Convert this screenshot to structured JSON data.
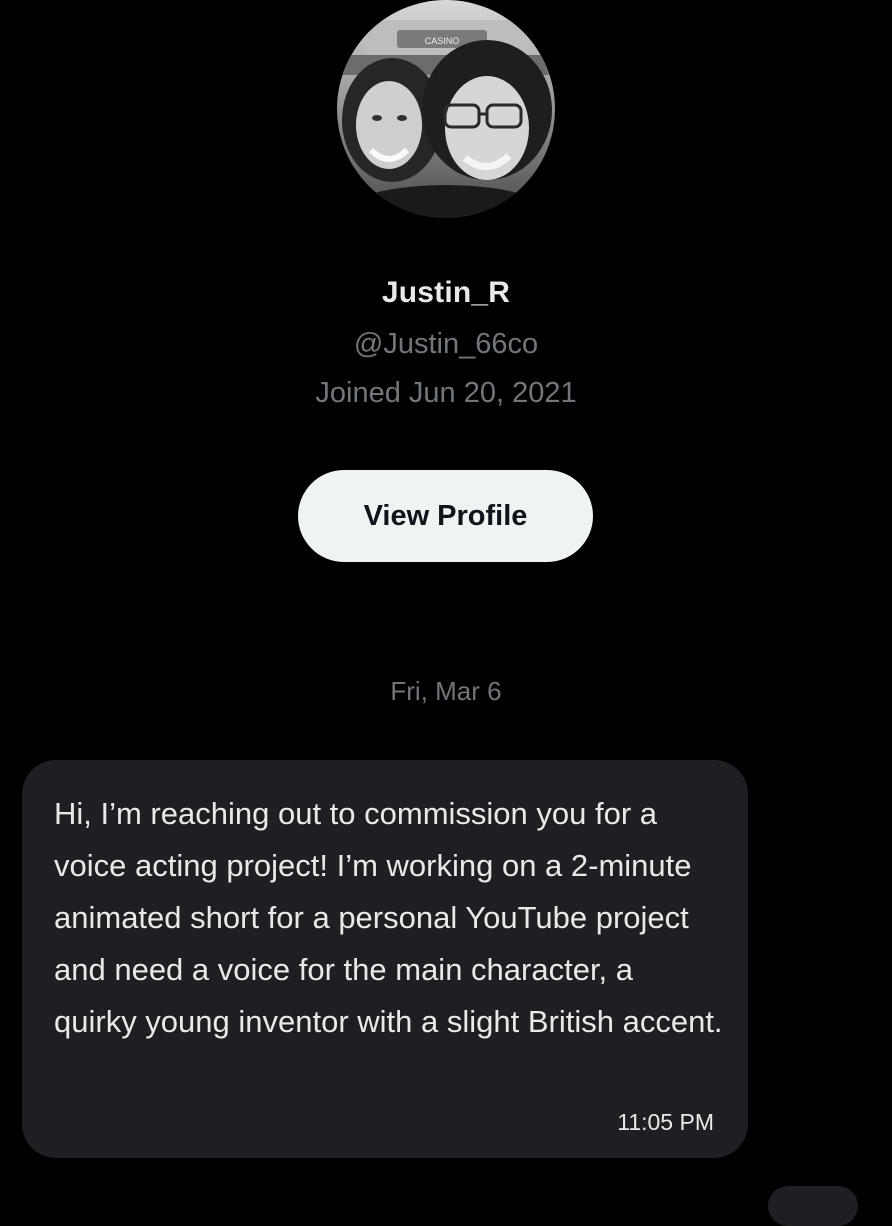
{
  "profile": {
    "display_name": "Justin_R",
    "handle": "@Justin_66co",
    "joined": "Joined Jun 20, 2021",
    "avatar_sign_text": "CASINO",
    "view_profile_label": "View Profile"
  },
  "conversation": {
    "date_separator": "Fri, Mar 6",
    "messages": [
      {
        "text": "Hi, I’m reaching out to commission you for a voice acting project! I’m working on a 2-minute animated short for a personal YouTube project and need a voice for the main character, a quirky young inventor with a slight British accent.",
        "time": "11:05 PM"
      }
    ]
  },
  "colors": {
    "background": "#000000",
    "primary_text": "#e7e9ea",
    "secondary_text": "#71767b",
    "button_bg": "#eff3f4",
    "bubble_bg": "#1e1f22"
  }
}
